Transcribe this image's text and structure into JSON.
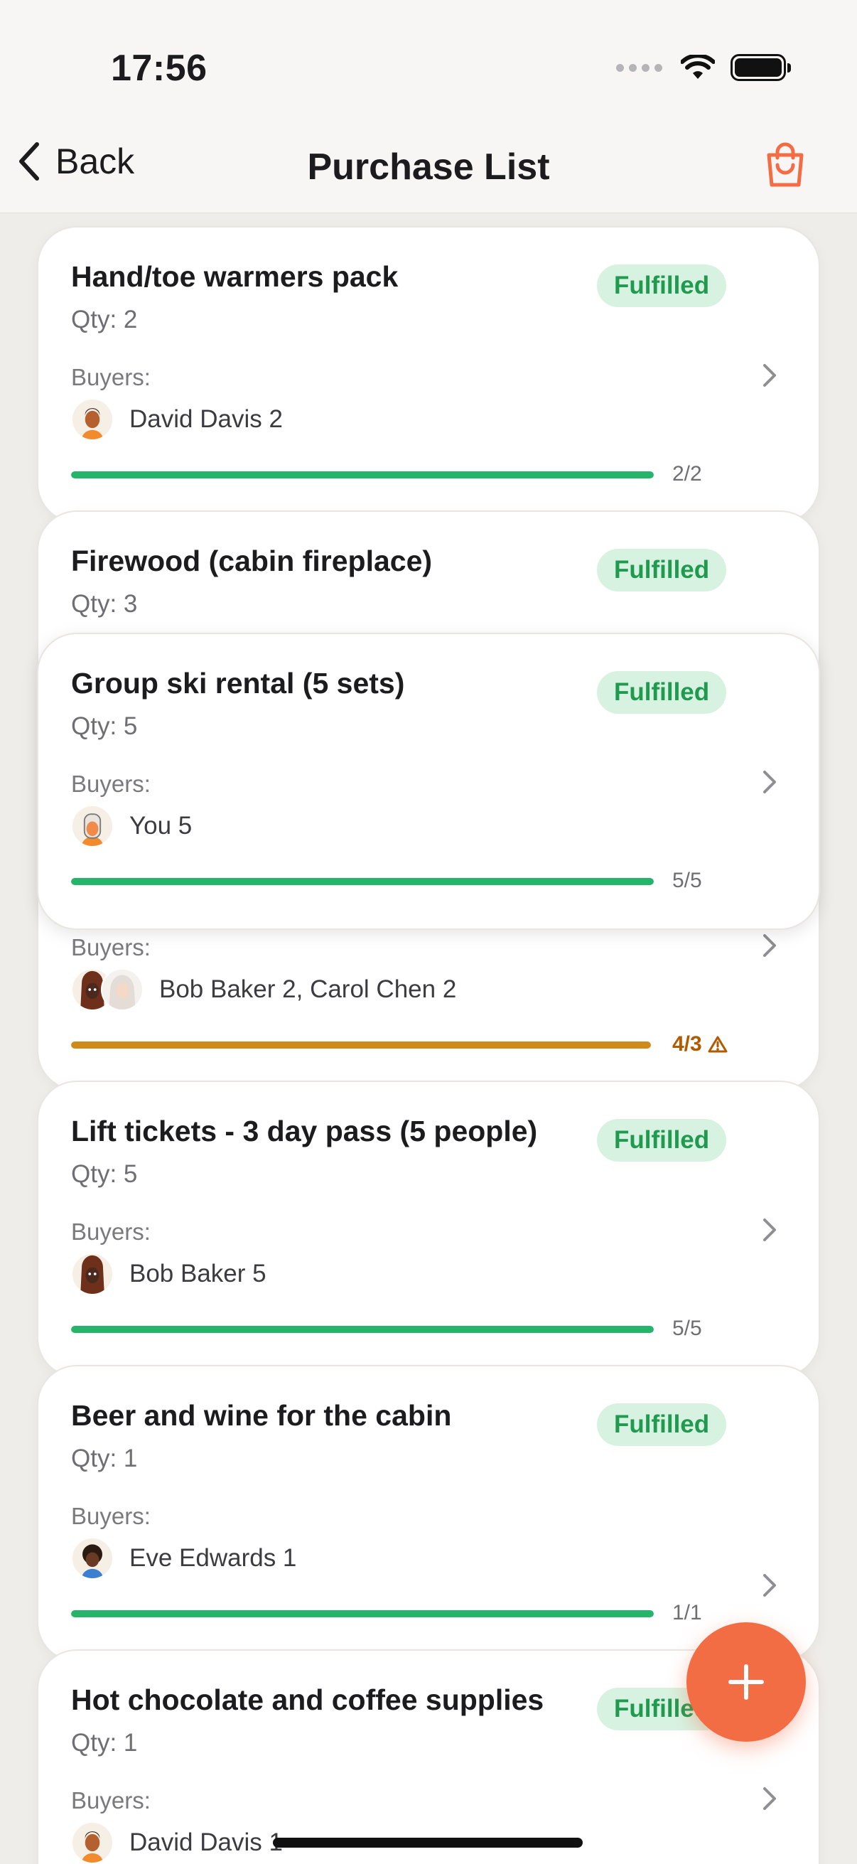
{
  "status_bar": {
    "time": "17:56"
  },
  "nav": {
    "back_label": "Back",
    "title": "Purchase List"
  },
  "items": [
    {
      "title": "Hand/toe warmers pack",
      "qty": "Qty: 2",
      "status": "Fulfilled",
      "buyers_label": "Buyers:",
      "buyers": "David Davis 2",
      "progress": "2/2",
      "fraction": 1.0
    },
    {
      "title": "Firewood (cabin fireplace)",
      "qty": "Qty: 3",
      "status": "Fulfilled",
      "buyers_label": "Buyers:",
      "buyers": "Bob Baker 2, Carol Chen 2",
      "progress": "4/3",
      "fraction": 1.33
    },
    {
      "title": "Group ski rental (5 sets)",
      "qty": "Qty: 5",
      "status": "Fulfilled",
      "buyers_label": "Buyers:",
      "buyers": "You 5",
      "progress": "5/5",
      "fraction": 1.0
    },
    {
      "title": "Lift tickets - 3 day pass (5 people)",
      "qty": "Qty: 5",
      "status": "Fulfilled",
      "buyers_label": "Buyers:",
      "buyers": "Bob Baker 5",
      "progress": "5/5",
      "fraction": 1.0
    },
    {
      "title": "Beer and wine for the cabin",
      "qty": "Qty: 1",
      "status": "Fulfilled",
      "buyers_label": "Buyers:",
      "buyers": "Eve Edwards 1",
      "progress": "1/1",
      "fraction": 1.0
    },
    {
      "title": "Hot chocolate and coffee supplies",
      "qty": "Qty: 1",
      "status": "Fulfilled",
      "buyers_label": "Buyers:",
      "buyers": "David Davis 1"
    }
  ],
  "colors": {
    "accent": "#f26c44",
    "fulfilled_bg": "#d8f2e1",
    "fulfilled_text": "#1f9a4f",
    "progress_ok": "#25b56a",
    "progress_over": "#d08a1a",
    "over_text": "#b25a00"
  },
  "icons": {
    "back": "chevron-left-icon",
    "cart": "shopping-bag-icon",
    "add": "plus-icon",
    "row": "chevron-right-icon",
    "warning": "warning-triangle-icon"
  }
}
